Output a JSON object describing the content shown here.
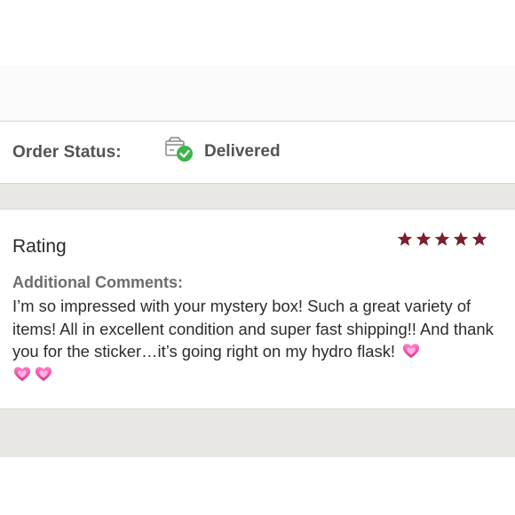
{
  "order": {
    "status_label": "Order Status:",
    "status_value": "Delivered",
    "status_icon": "box-check-icon"
  },
  "review": {
    "title": "Rating",
    "rating": 5,
    "rating_max": 5,
    "comments_label": "Additional Comments:",
    "comments_text": "I’m so impressed with your mystery box! Such a great variety of items! All in excellent condition and super fast shipping!! And thank you for the sticker…it’s going right on my hydro flask!",
    "emoji": "sparkling-heart-icon",
    "emoji_count": 3
  },
  "colors": {
    "star": "#7a1f2e",
    "check": "#3bb54a",
    "text_dark": "#2c2c2c",
    "text_gray": "#555252",
    "band_gray": "#e9e7e3"
  }
}
